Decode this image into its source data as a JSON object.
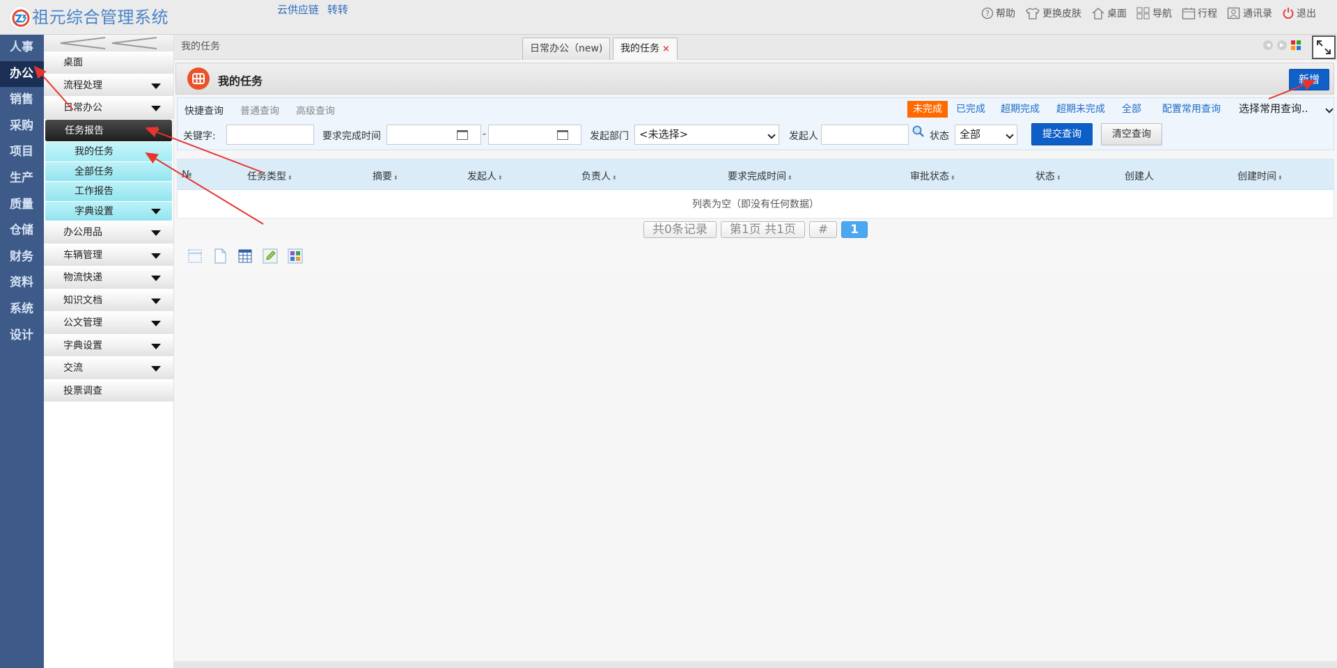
{
  "header": {
    "title": "祖元综合管理系统",
    "links": [
      "云供应链",
      "转转"
    ],
    "tools": [
      {
        "icon": "help-icon",
        "label": "帮助"
      },
      {
        "icon": "shirt-icon",
        "label": "更换皮肤"
      },
      {
        "icon": "home-icon",
        "label": "桌面"
      },
      {
        "icon": "grid-icon",
        "label": "导航"
      },
      {
        "icon": "calendar-icon",
        "label": "行程"
      },
      {
        "icon": "contacts-icon",
        "label": "通讯录"
      },
      {
        "icon": "power-icon",
        "label": "退出"
      }
    ]
  },
  "modules": [
    "人事",
    "办公",
    "销售",
    "采购",
    "项目",
    "生产",
    "质量",
    "仓储",
    "财务",
    "资料",
    "系统",
    "设计"
  ],
  "active_module": "办公",
  "nav": {
    "items": [
      {
        "label": "桌面",
        "caret": false
      },
      {
        "label": "流程处理",
        "caret": true
      },
      {
        "label": "日常办公",
        "caret": true
      },
      {
        "label": "任务报告",
        "caret": true,
        "open": true
      }
    ],
    "subitems": [
      {
        "label": "我的任务",
        "caret": false
      },
      {
        "label": "全部任务",
        "caret": false
      },
      {
        "label": "工作报告",
        "caret": false
      },
      {
        "label": "字典设置",
        "caret": true
      }
    ],
    "items_after": [
      {
        "label": "办公用品",
        "caret": true
      },
      {
        "label": "车辆管理",
        "caret": true
      },
      {
        "label": "物流快递",
        "caret": true
      },
      {
        "label": "知识文档",
        "caret": true
      },
      {
        "label": "公文管理",
        "caret": true
      },
      {
        "label": "字典设置",
        "caret": true
      },
      {
        "label": "交流",
        "caret": true
      },
      {
        "label": "投票调查",
        "caret": false
      }
    ]
  },
  "crumb": "我的任务",
  "tabs": [
    {
      "label": "日常办公（new)"
    },
    {
      "label": "我的任务",
      "close": "×"
    }
  ],
  "panel": {
    "title": "我的任务",
    "add_label": "新增"
  },
  "query": {
    "modes": [
      "快捷查询",
      "普通查询",
      "高级查询"
    ],
    "filters": [
      "未完成",
      "已完成",
      "超期完成",
      "超期未完成",
      "全部"
    ],
    "config_label": "配置常用查询",
    "common_select": "选择常用查询..",
    "keyword_label": "关键字:",
    "time_label": "要求完成时间",
    "dash": "-",
    "dept_label": "发起部门",
    "dept_value": "<未选择>",
    "initiator_label": "发起人",
    "status_label": "状态",
    "status_value": "全部",
    "submit_label": "提交查询",
    "clear_label": "清空查询"
  },
  "grid": {
    "columns": [
      "№",
      "任务类型",
      "摘要",
      "发起人",
      "负责人",
      "要求完成时间",
      "审批状态",
      "状态",
      "创建人",
      "创建时间"
    ],
    "empty_text": "列表为空（即没有任何数据）"
  },
  "pager": {
    "total": "共0条记录",
    "page": "第1页 共1页",
    "hash": "#",
    "current": "1"
  },
  "colors": {
    "module_bg": "#3d5a88",
    "accent": "#1060c8",
    "filter_active": "#ff6a00",
    "annotation": "#e8342d"
  }
}
